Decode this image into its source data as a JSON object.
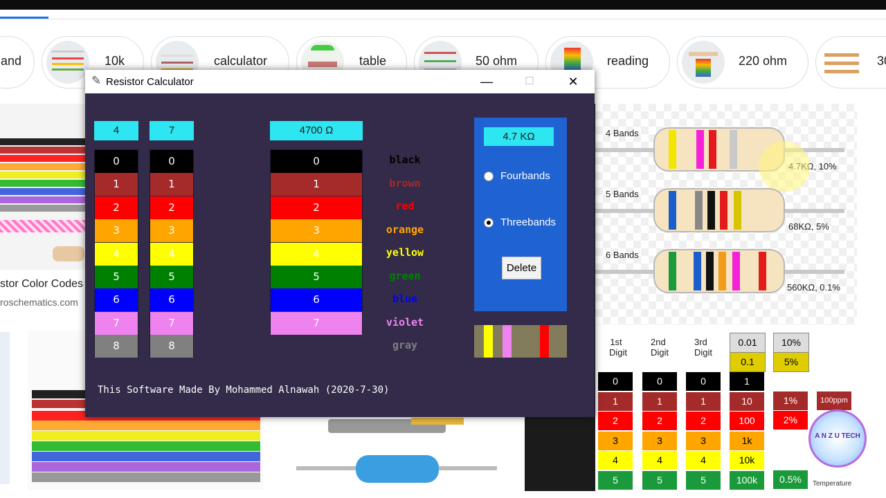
{
  "browser": {
    "chips": [
      {
        "label": "and"
      },
      {
        "label": "10k"
      },
      {
        "label": "calculator"
      },
      {
        "label": "table"
      },
      {
        "label": "50 ohm"
      },
      {
        "label": "reading"
      },
      {
        "label": "220 ohm"
      },
      {
        "label": "30"
      }
    ],
    "background_text": {
      "color_codes_title": "stor Color Codes",
      "source": "roschematics.com"
    }
  },
  "window": {
    "title": "Resistor Calculator",
    "controls": {
      "minimize": "—",
      "maximize": "☐",
      "close": "✕"
    },
    "band1": {
      "selected": "4",
      "values": [
        "0",
        "1",
        "2",
        "3",
        "4",
        "5",
        "6",
        "7",
        "8"
      ]
    },
    "band2": {
      "selected": "7",
      "values": [
        "0",
        "1",
        "2",
        "3",
        "4",
        "5",
        "6",
        "7",
        "8"
      ]
    },
    "multiplier": {
      "selected": "4700 Ω",
      "values": [
        "0",
        "1",
        "2",
        "3",
        "4",
        "5",
        "6",
        "7"
      ]
    },
    "color_names": [
      "black",
      "brown",
      "red",
      "orange",
      "yellow",
      "green",
      "blue",
      "violet",
      "gray"
    ],
    "colors": {
      "black": "#000000",
      "brown": "#a52a2a",
      "red": "#ff0000",
      "orange": "#ffa500",
      "yellow": "#ffff00",
      "green": "#008000",
      "blue": "#0000ff",
      "violet": "#ee82ee",
      "gray": "#808080"
    },
    "result": "4.7  KΩ",
    "options": [
      {
        "label": "Fourbands",
        "checked": false
      },
      {
        "label": "Threebands",
        "checked": true
      }
    ],
    "delete_label": "Delete",
    "credit": "This Software Made By Mohammed Alnawah (2020-7-30)"
  },
  "diagram": {
    "rows": [
      {
        "label": "4 Bands",
        "value": "4.7KΩ, 10%"
      },
      {
        "label": "5 Bands",
        "value": "68KΩ, 5%"
      },
      {
        "label": "6 Bands",
        "value": "560KΩ, 0.1%"
      }
    ],
    "columns": [
      {
        "label": "1st\nDigit"
      },
      {
        "label": "2nd\nDigit"
      },
      {
        "label": "3rd\nDigit"
      }
    ],
    "multiplier_head": [
      "0.01",
      "0.1"
    ],
    "tolerance_head": [
      "10%",
      "5%"
    ],
    "digit_values": [
      "0",
      "1",
      "2",
      "3",
      "4",
      "5"
    ],
    "multiplier_values": [
      "1",
      "10",
      "100",
      "1k",
      "10k",
      "100k"
    ],
    "tolerance_values": [
      "1%",
      "2%",
      "0.5%"
    ],
    "tempco": "100ppm",
    "logo_text": "A N Z U TECH",
    "temperature_label": "Temperature"
  }
}
